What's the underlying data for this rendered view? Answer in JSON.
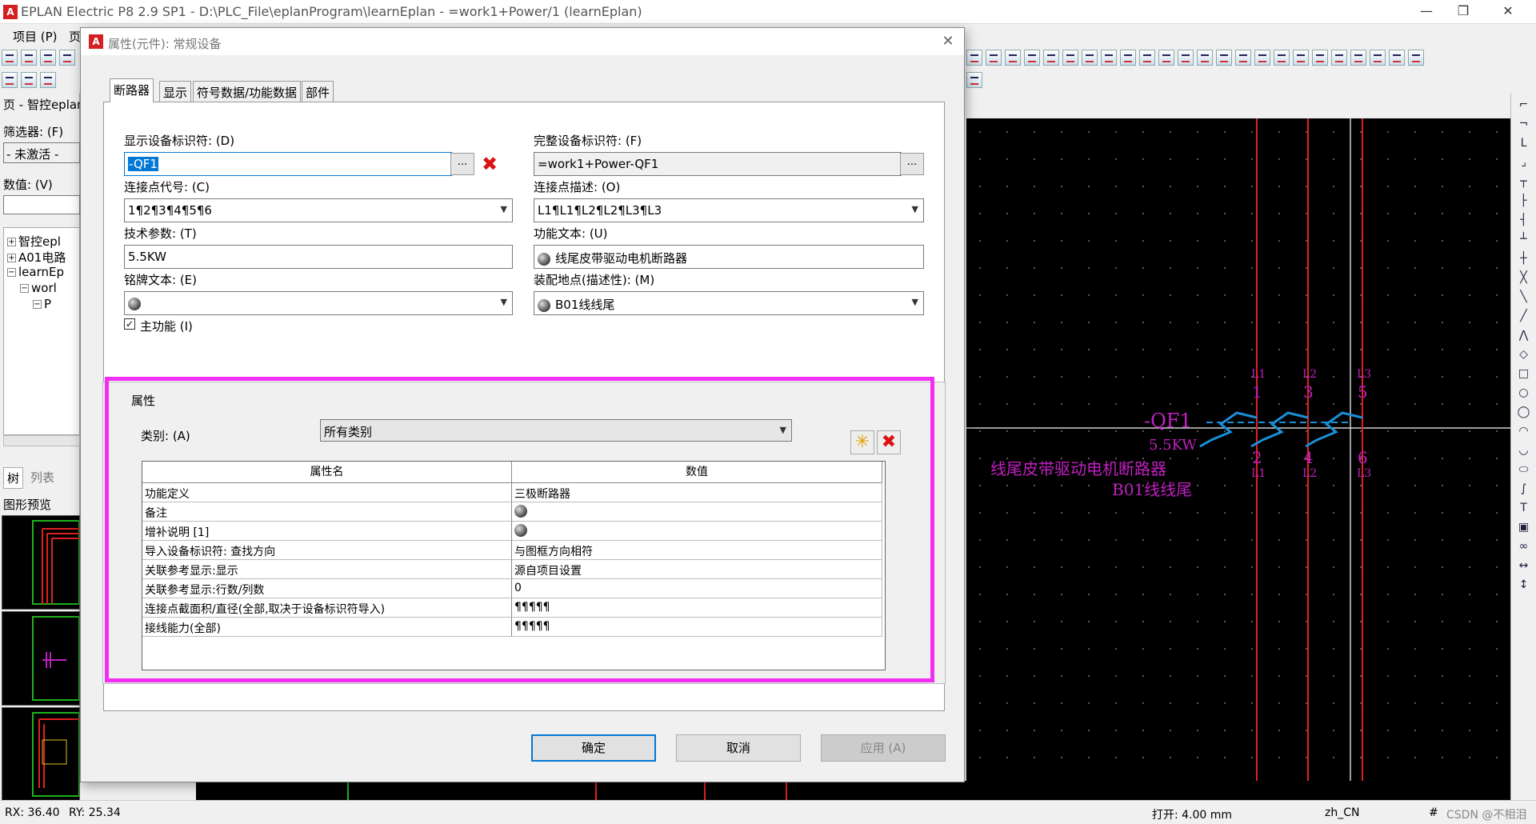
{
  "app": {
    "title": "EPLAN Electric P8 2.9 SP1 - D:\\PLC_File\\eplanProgram\\learnEplan - =work1+Power/1 (learnEplan)",
    "logo_text": "A",
    "min_btn": "—",
    "restore_btn": "❐",
    "close_btn": "✕",
    "menu": [
      "项目 (P)",
      "页"
    ]
  },
  "left_panel": {
    "header": "页 - 智控eplan",
    "filter_label": "筛选器: (F)",
    "filter_value": "- 未激活 -",
    "value_label": "数值: (V)",
    "tree": [
      {
        "expander": "+",
        "label": "智控epl"
      },
      {
        "expander": "+",
        "label": "A01电路"
      },
      {
        "expander": "−",
        "label": "learnEp"
      },
      {
        "expander": "−",
        "label": "worl"
      },
      {
        "expander": "−",
        "label": "P"
      }
    ],
    "tabs": [
      "树",
      "列表"
    ],
    "preview_label": "图形预览"
  },
  "dialog": {
    "title": "属性(元件): 常规设备",
    "logo_text": "A",
    "close": "✕",
    "tabs": [
      "断路器",
      "显示",
      "符号数据/功能数据",
      "部件"
    ],
    "fields": {
      "display_id_label": "显示设备标识符: (D)",
      "display_id_value": "-QF1",
      "full_id_label": "完整设备标识符: (F)",
      "full_id_value": "=work1+Power-QF1",
      "conn_code_label": "连接点代号: (C)",
      "conn_code_value": "1¶2¶3¶4¶5¶6",
      "conn_desc_label": "连接点描述: (O)",
      "conn_desc_value": "L1¶L1¶L2¶L2¶L3¶L3",
      "tech_label": "技术参数: (T)",
      "tech_value": "5.5KW",
      "func_text_label": "功能文本: (U)",
      "func_text_value": "线尾皮带驱动电机断路器",
      "nameplate_label": "铭牌文本: (E)",
      "nameplate_value": "",
      "mount_label": "装配地点(描述性): (M)",
      "mount_value": "B01线线尾",
      "main_func_label": "主功能 (I)",
      "dots": "...",
      "x": "✖"
    },
    "props": {
      "group_label": "属性",
      "category_label": "类别: (A)",
      "category_value": "所有类别",
      "new_btn": "✳",
      "del_btn": "✖",
      "col_name": "属性名",
      "col_value": "数值",
      "rows": [
        {
          "name": "功能定义",
          "value": "三极断路器",
          "globe": false
        },
        {
          "name": "备注",
          "value": "",
          "globe": true
        },
        {
          "name": "增补说明 [1]",
          "value": "",
          "globe": true
        },
        {
          "name": "导入设备标识符: 查找方向",
          "value": "与图框方向相符",
          "globe": false
        },
        {
          "name": "关联参考显示:显示",
          "value": "源自项目设置",
          "globe": false
        },
        {
          "name": "关联参考显示:行数/列数",
          "value": "0",
          "globe": false
        },
        {
          "name": "连接点截面积/直径(全部,取决于设备标识符导入)",
          "value": "¶¶¶¶¶",
          "globe": false
        },
        {
          "name": "接线能力(全部)",
          "value": "¶¶¶¶¶",
          "globe": false
        }
      ]
    },
    "buttons": {
      "ok": "确定",
      "cancel": "取消",
      "apply": "应用 (A)"
    }
  },
  "schematic": {
    "device_tag": "-QF1",
    "tech_value": "5.5KW",
    "func_text": "线尾皮带驱动电机断路器",
    "location": "B01线线尾",
    "top_labels": [
      "L1",
      "L2",
      "L3"
    ],
    "top_numbers": [
      "1",
      "3",
      "5"
    ],
    "bottom_numbers": [
      "2",
      "4",
      "6"
    ],
    "bottom_labels": [
      "L1",
      "L2",
      "L3"
    ],
    "colors": {
      "wire": "#e02020",
      "text": "#c020c0",
      "symbol": "#1a8fd8",
      "background": "#000000"
    }
  },
  "status": {
    "rx": "RX: 36.40",
    "ry": "RY: 25.34",
    "open": "打开: 4.00 mm",
    "lang": "zh_CN",
    "hash": "#",
    "watermark": "CSDN @不相泪"
  }
}
